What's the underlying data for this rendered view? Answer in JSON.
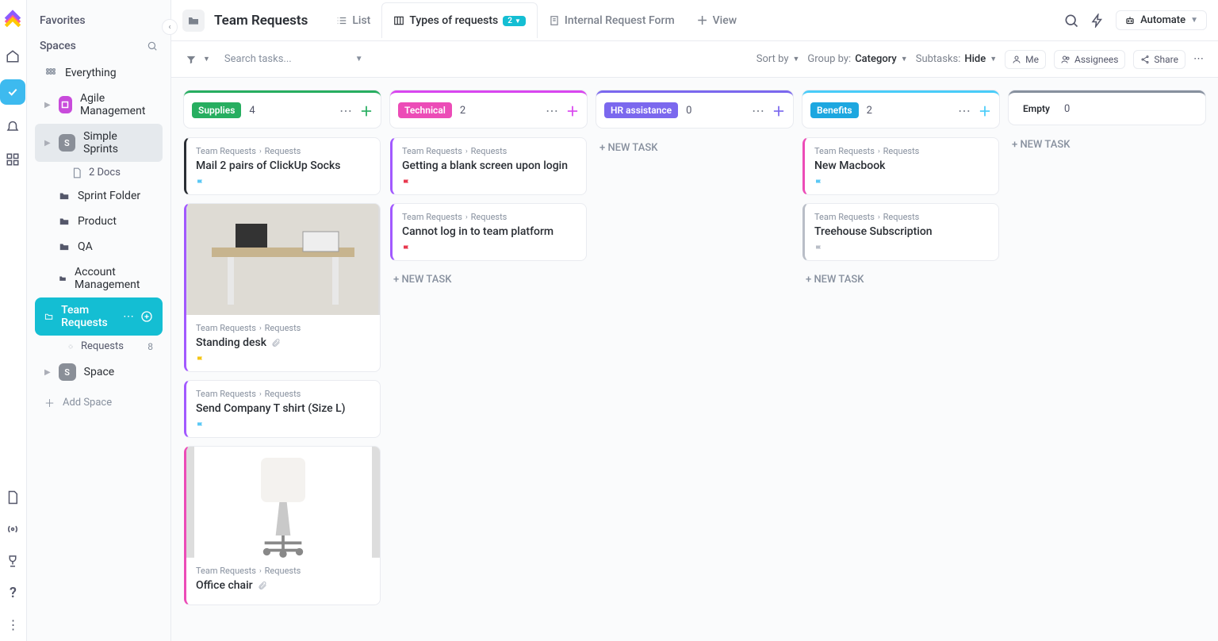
{
  "rail": {
    "icons": [
      "home",
      "check",
      "bell",
      "apps",
      "doc",
      "broadcast",
      "trophy",
      "help",
      "more"
    ]
  },
  "sidebar": {
    "favorites_label": "Favorites",
    "spaces_label": "Spaces",
    "everything": "Everything",
    "agile": {
      "label": "Agile Management"
    },
    "ss": {
      "label": "Simple Sprints",
      "initial": "S",
      "docs": "2 Docs"
    },
    "folders": [
      "Sprint Folder",
      "Product",
      "QA",
      "Account Management"
    ],
    "active": {
      "label": "Team Requests"
    },
    "requests": {
      "label": "Requests",
      "count": "8"
    },
    "space": {
      "label": "Space",
      "initial": "S"
    },
    "add_space": "Add Space"
  },
  "header": {
    "title": "Team Requests",
    "tabs": [
      {
        "label": "List",
        "icon": "list"
      },
      {
        "label": "Types of requests",
        "icon": "board",
        "badge": "2"
      },
      {
        "label": "Internal Request Form",
        "icon": "form"
      },
      {
        "label": "View",
        "icon": "plus"
      }
    ],
    "automate": "Automate"
  },
  "toolbar": {
    "search": "Search tasks...",
    "sort": "Sort by",
    "group": "Group by:",
    "group_val": "Category",
    "subtasks": "Subtasks:",
    "subtasks_val": "Hide",
    "me": "Me",
    "assignees": "Assignees",
    "share": "Share"
  },
  "columns": [
    {
      "name": "Supplies",
      "count": "4",
      "bar": "#27ae60",
      "tag": "#27ae60",
      "plus": "#27ae60",
      "cards": [
        {
          "edge": "#2a2e34",
          "crumb": [
            "Team Requests",
            "Requests"
          ],
          "title": "Mail 2 pairs of ClickUp Socks",
          "flag": "#5bc8f5"
        },
        {
          "edge": "#a259ff",
          "img": "desk",
          "crumb": [
            "Team Requests",
            "Requests"
          ],
          "title": "Standing desk",
          "attach": true,
          "flag": "#f4c616"
        },
        {
          "edge": "#a259ff",
          "crumb": [
            "Team Requests",
            "Requests"
          ],
          "title": "Send Company T shirt (Size L)",
          "flag": "#5bc8f5"
        },
        {
          "edge": "#ec4cb7",
          "img": "chair",
          "crumb": [
            "Team Requests",
            "Requests"
          ],
          "title": "Office chair",
          "attach": true
        }
      ]
    },
    {
      "name": "Technical",
      "count": "2",
      "bar": "#d946ef",
      "tag": "#ec4cb7",
      "plus": "#d946ef",
      "cards": [
        {
          "edge": "#a259ff",
          "crumb": [
            "Team Requests",
            "Requests"
          ],
          "title": "Getting a blank screen upon login",
          "flag": "#e8384f"
        },
        {
          "edge": "#a259ff",
          "crumb": [
            "Team Requests",
            "Requests"
          ],
          "title": "Cannot log in to team platform",
          "flag": "#e8384f"
        }
      ],
      "newtask": "+ NEW TASK"
    },
    {
      "name": "HR assistance",
      "count": "0",
      "bar": "#7b68ee",
      "tag": "#7b68ee",
      "plus": "#7b68ee",
      "newtask": "+ NEW TASK"
    },
    {
      "name": "Benefits",
      "count": "2",
      "bar": "#49ccf9",
      "tag": "#1da7e0",
      "plus": "#49ccf9",
      "cards": [
        {
          "edge": "#ec4cb7",
          "crumb": [
            "Team Requests",
            "Requests"
          ],
          "title": "New Macbook",
          "flag": "#5bc8f5"
        },
        {
          "edge": "#b9bec7",
          "crumb": [
            "Team Requests",
            "Requests"
          ],
          "title": "Treehouse Subscription",
          "flag": "#b9bec7"
        }
      ],
      "newtask": "+ NEW TASK"
    },
    {
      "name": "Empty",
      "count": "0",
      "bar": "#87909e",
      "plain": true,
      "newtask": "+ NEW TASK"
    }
  ]
}
